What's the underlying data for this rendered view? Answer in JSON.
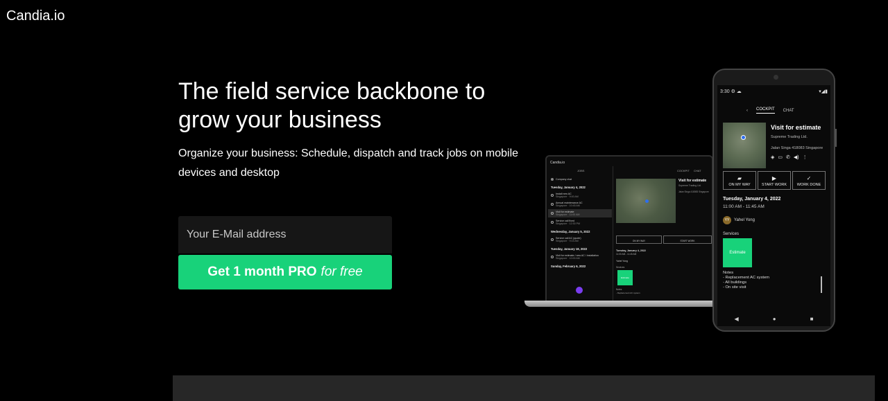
{
  "brand": {
    "name": "Candia.io"
  },
  "hero": {
    "title": "The field service backbone to grow your business",
    "subtitle": "Organize your business: Schedule, dispatch and track jobs on mobile devices and desktop"
  },
  "signup": {
    "email_placeholder": "Your E-Mail address",
    "cta_main": "Get 1 month PRO",
    "cta_emphasis": "for free"
  },
  "colors": {
    "accent": "#18d27a",
    "background": "#000000",
    "panel": "#272727"
  },
  "laptop": {
    "brand": "Candia.io",
    "list_tab": "JOBS",
    "detail_tabs": [
      "COCKPIT",
      "CHAT"
    ],
    "sections": [
      {
        "date": "Tuesday, January 4, 2022",
        "items": [
          {
            "title": "Company chat",
            "sub": ""
          },
          {
            "title": "Install new AC",
            "sub": "Singapore · 9:00 AM"
          },
          {
            "title": "Annual maintenance AC",
            "sub": "Singapore · 10:45 AM"
          },
          {
            "title": "Visit for estimate",
            "sub": "Singapore · 11:00 AM"
          },
          {
            "title": "Service call fixed",
            "sub": "Singapore · 12:30 PM"
          }
        ]
      },
      {
        "date": "Wednesday, January 5, 2022",
        "items": [
          {
            "title": "Service call AC (quote)",
            "sub": "Singapore · 9:15 AM"
          }
        ]
      },
      {
        "date": "Tuesday, January 18, 2022",
        "items": [
          {
            "title": "Visit for estimate / new AC / installation",
            "sub": "Singapore · 10:00 AM"
          }
        ]
      },
      {
        "date": "Sunday, February 6, 2022",
        "items": []
      }
    ],
    "detail": {
      "title": "Visit for estimate",
      "company": "Supreme Trading Ltd.",
      "address": "Jalan Singa 418083 Singapore",
      "buttons": [
        "ON MY WAY",
        "START WORK"
      ],
      "date": "Tuesday, January 4, 2022",
      "time": "11:00 AM - 11:45 AM",
      "user": "Yahel Yong",
      "services_label": "Services",
      "service": "Estimate",
      "notes_label": "Notes",
      "note": "- Replacement AC system"
    }
  },
  "phone": {
    "time": "3:30",
    "tabs": [
      "COCKPIT",
      "CHAT"
    ],
    "job_title": "Visit for estimate",
    "company": "Supreme Trading Ltd.",
    "address": "Jalan Singa 418083 Singapore",
    "buttons": [
      "ON MY WAY",
      "START WORK",
      "WORK DONE"
    ],
    "date": "Tuesday, January 4, 2022",
    "time_range": "11:00 AM - 11:45 AM",
    "user_initials": "YY",
    "user_name": "Yahel Yong",
    "services_label": "Services",
    "service": "Estimate",
    "notes_label": "Notes",
    "notes": [
      "- Replacement AC system",
      "- All buildings",
      "- On site visit"
    ]
  }
}
